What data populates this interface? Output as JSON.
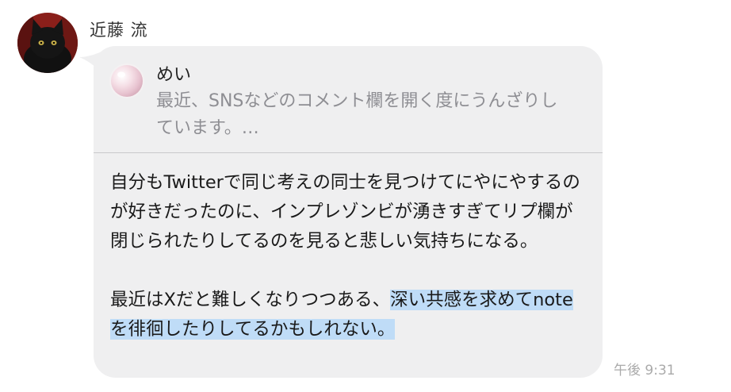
{
  "sender": {
    "name": "近藤 流",
    "avatar_icon": "black-cat-avatar"
  },
  "quote": {
    "author": "めい",
    "text": "最近、SNSなどのコメント欄を開く度にうんざりしています。…",
    "avatar_icon": "pearl-avatar"
  },
  "message": {
    "paragraph1": "自分もTwitterで同じ考えの同士を見つけてにやにやするのが好きだったのに、インプレゾンビが湧きすぎてリプ欄が閉じられたりしてるのを見ると悲しい気持ちになる。",
    "paragraph2_plain": "最近はXだと難しくなりつつある、",
    "paragraph2_highlight": "深い共感を求めてnoteを徘徊したりしてるかもしれない。"
  },
  "timestamp": "午後 9:31",
  "colors": {
    "bubble": "#efeff0",
    "highlight": "#bfdcf7",
    "muted_text": "#8e8e93"
  }
}
